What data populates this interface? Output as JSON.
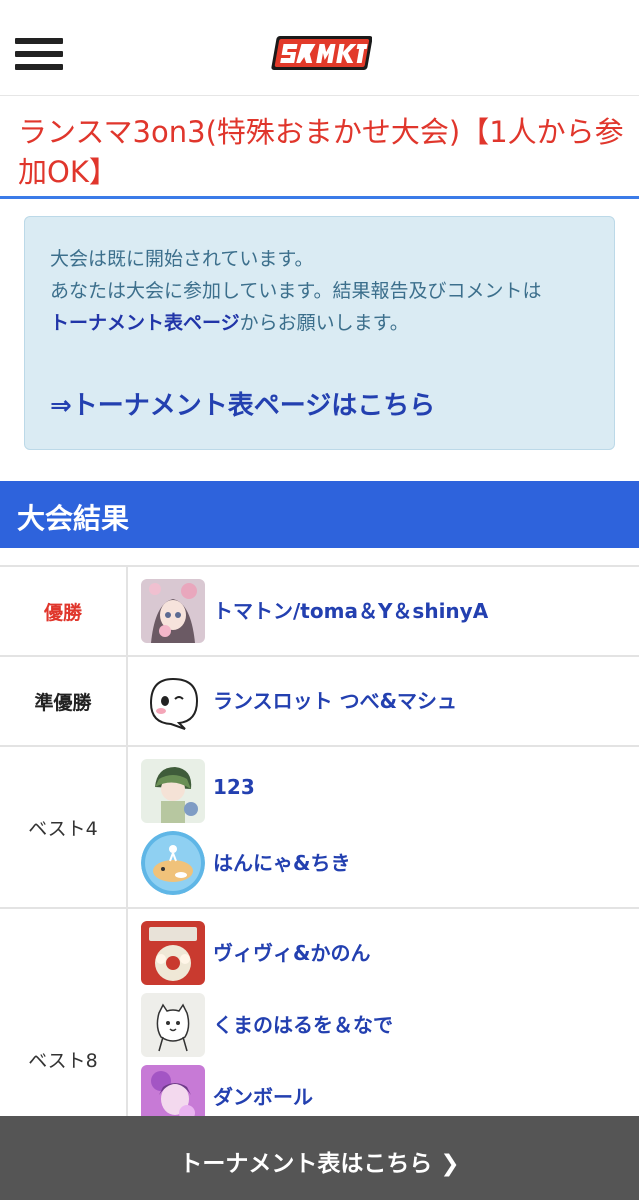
{
  "header": {
    "menu_icon": "hamburger-menu-icon",
    "logo_text": "スマメイト"
  },
  "tournament": {
    "title": "ランスマ3on3(特殊おまかせ大会)【1人から参加OK】"
  },
  "notice": {
    "line1": "大会は既に開始されています。",
    "line2_prefix": "あなたは大会に参加しています。結果報告及びコメントは",
    "line2_link": "トーナメント表ページ",
    "line2_suffix": "からお願いします。",
    "link_label": "⇒トーナメント表ページはこちら"
  },
  "results": {
    "section_title": "大会結果",
    "rows": [
      {
        "rank": "優勝",
        "entries": [
          {
            "name": "トマトン/toma＆Y＆shinyA",
            "avatar": "anime-girl-avatar"
          }
        ]
      },
      {
        "rank": "準優勝",
        "entries": [
          {
            "name": "ランスロット つべ&マシュ",
            "avatar": "ghost-avatar"
          }
        ]
      },
      {
        "rank": "ベスト4",
        "entries": [
          {
            "name": "123",
            "avatar": "green-hair-character-avatar"
          },
          {
            "name": "はんにゃ&ちき",
            "avatar": "hamster-avatar"
          }
        ]
      },
      {
        "rank": "ベスト8",
        "entries": [
          {
            "name": "ヴィヴィ&かのん",
            "avatar": "donut-avatar"
          },
          {
            "name": "くまのはるを＆なで",
            "avatar": "bear-sketch-avatar"
          },
          {
            "name": "ダンボール",
            "avatar": "purple-character-avatar"
          }
        ]
      }
    ]
  },
  "bottom_bar": {
    "label": "トーナメント表はこちら ❯"
  },
  "colors": {
    "accent_blue": "#2e63dc",
    "title_red": "#e0362c",
    "link_blue": "#2340b0",
    "notice_bg": "#daebf3",
    "bottom_bar": "#555555"
  }
}
